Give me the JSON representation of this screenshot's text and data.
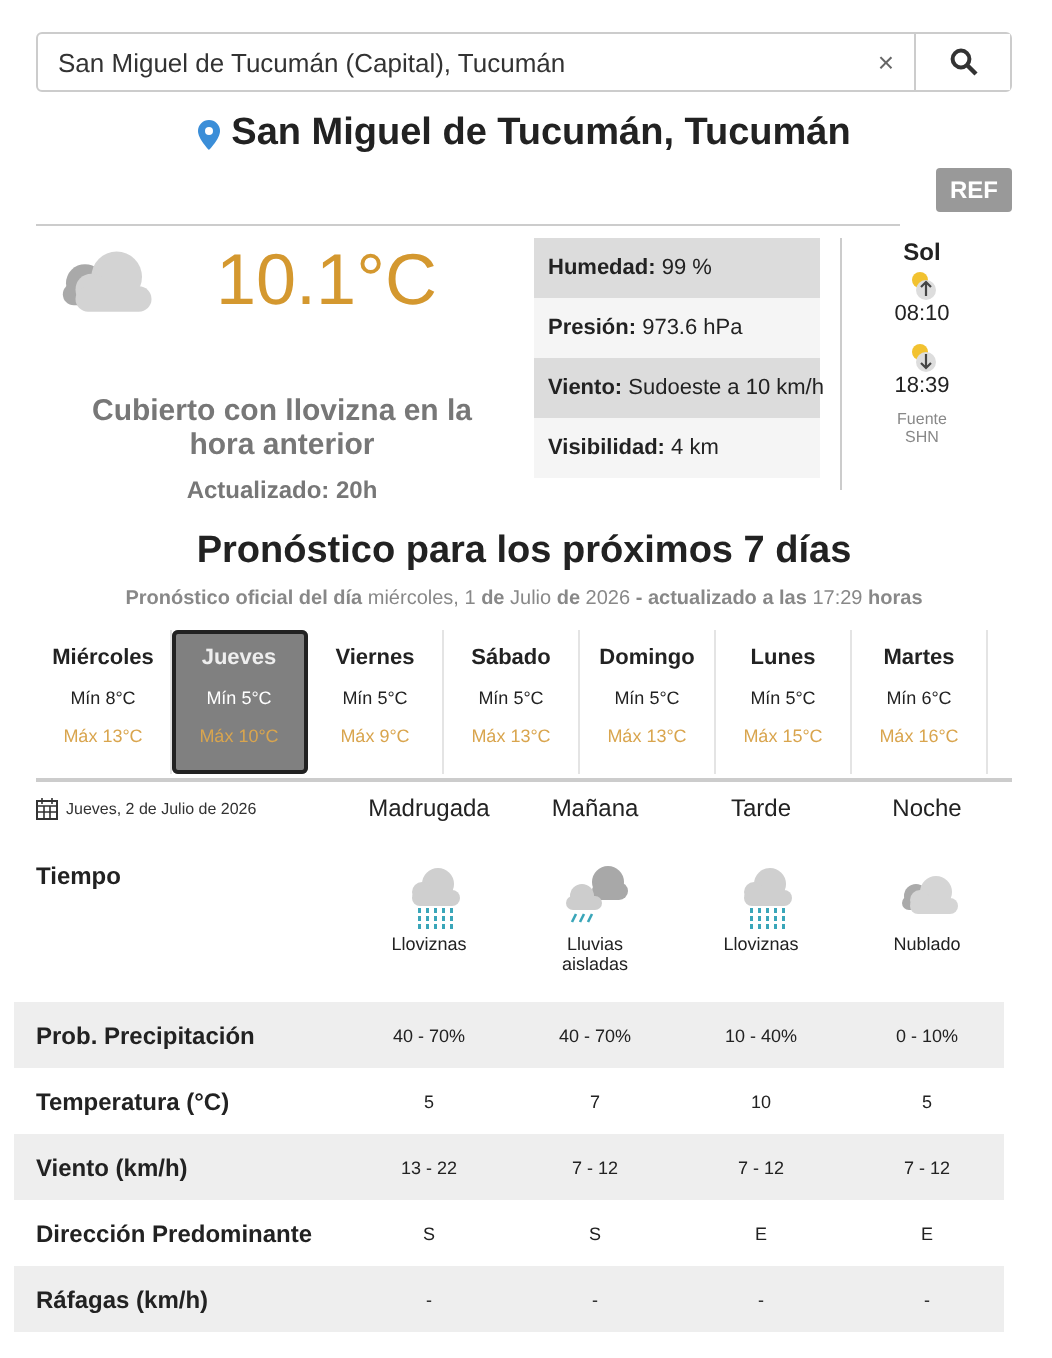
{
  "search": {
    "value": "San Miguel de Tucumán (Capital), Tucumán",
    "clear": "×"
  },
  "location": {
    "title": "San Miguel de Tucumán, Tucumán"
  },
  "ref_button": "REF",
  "current": {
    "temperature": "10.1°C",
    "description": "Cubierto con llovizna en la hora anterior",
    "updated": "Actualizado: 20h",
    "details": [
      {
        "label": "Humedad:",
        "value": "99 %"
      },
      {
        "label": "Presión:",
        "value": "973.6 hPa"
      },
      {
        "label": "Viento:",
        "value": "Sudoeste a 10 km/h"
      },
      {
        "label": "Visibilidad:",
        "value": "4 km"
      }
    ],
    "sun": {
      "title": "Sol",
      "sunrise": "08:10",
      "sunset": "18:39",
      "source": "Fuente SHN"
    }
  },
  "forecast": {
    "title": "Pronóstico para los próximos 7 días",
    "subtitle": "**Pronóstico oficial del día** miércoles, 1 **de** Julio **de** 2026 **- actualizado a las** 17:29 **horas**",
    "days": [
      {
        "name": "Miércoles",
        "min": "Mín 8°C",
        "max": "Máx 13°C",
        "selected": false
      },
      {
        "name": "Jueves",
        "min": "Mín 5°C",
        "max": "Máx 10°C",
        "selected": true
      },
      {
        "name": "Viernes",
        "min": "Mín 5°C",
        "max": "Máx 9°C",
        "selected": false
      },
      {
        "name": "Sábado",
        "min": "Mín 5°C",
        "max": "Máx 13°C",
        "selected": false
      },
      {
        "name": "Domingo",
        "min": "Mín 5°C",
        "max": "Máx 13°C",
        "selected": false
      },
      {
        "name": "Lunes",
        "min": "Mín 5°C",
        "max": "Máx 15°C",
        "selected": false
      },
      {
        "name": "Martes",
        "min": "Mín 6°C",
        "max": "Máx 16°C",
        "selected": false
      }
    ]
  },
  "detail": {
    "date": "Jueves, 2 de Julio de 2026",
    "periods": [
      "Madrugada",
      "Mañana",
      "Tarde",
      "Noche"
    ],
    "weather_label": "Tiempo",
    "weather": [
      {
        "kind": "drizzle",
        "text": "Lloviznas"
      },
      {
        "kind": "isolated_rain",
        "text": "Lluvias aisladas"
      },
      {
        "kind": "drizzle",
        "text": "Lloviznas"
      },
      {
        "kind": "cloudy",
        "text": "Nublado"
      }
    ],
    "rows": [
      {
        "label": "Prob. Precipitación",
        "values": [
          "40 - 70%",
          "40 - 70%",
          "10 - 40%",
          "0 - 10%"
        ]
      },
      {
        "label": "Temperatura (°C)",
        "values": [
          "5",
          "7",
          "10",
          "5"
        ]
      },
      {
        "label": "Viento (km/h)",
        "values": [
          "13 - 22",
          "7 - 12",
          "7 - 12",
          "7 - 12"
        ]
      },
      {
        "label": "Dirección Predominante",
        "values": [
          "S",
          "S",
          "E",
          "E"
        ]
      },
      {
        "label": "Ráfagas (km/h)",
        "values": [
          "-",
          "-",
          "-",
          "-"
        ]
      }
    ]
  }
}
